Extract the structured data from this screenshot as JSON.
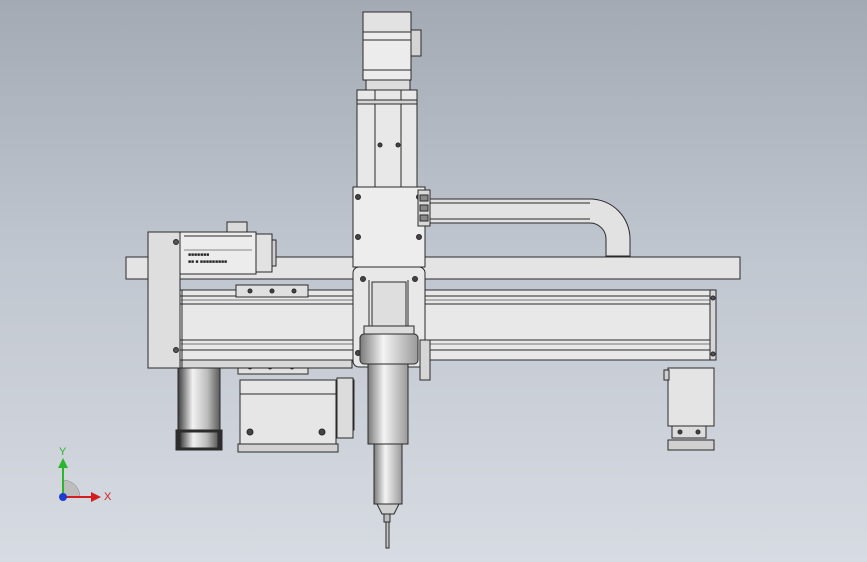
{
  "scene": {
    "view": "front",
    "model": "gantry-xz-axis-with-spindle",
    "colors": {
      "background_top": "#a4aab3",
      "background_bottom": "#d7dbe2",
      "metal": "#e6e6e6",
      "outline": "#2a2a2a"
    }
  },
  "motor_labels": {
    "line1": "■■■■■■■",
    "line2": "■■ ■ ■■■■■■■■■"
  },
  "triad": {
    "y_label": "Y",
    "x_label": "X",
    "y_color": "#2db52d",
    "x_color": "#d21e1e",
    "origin_color": "#1e3cd2"
  }
}
